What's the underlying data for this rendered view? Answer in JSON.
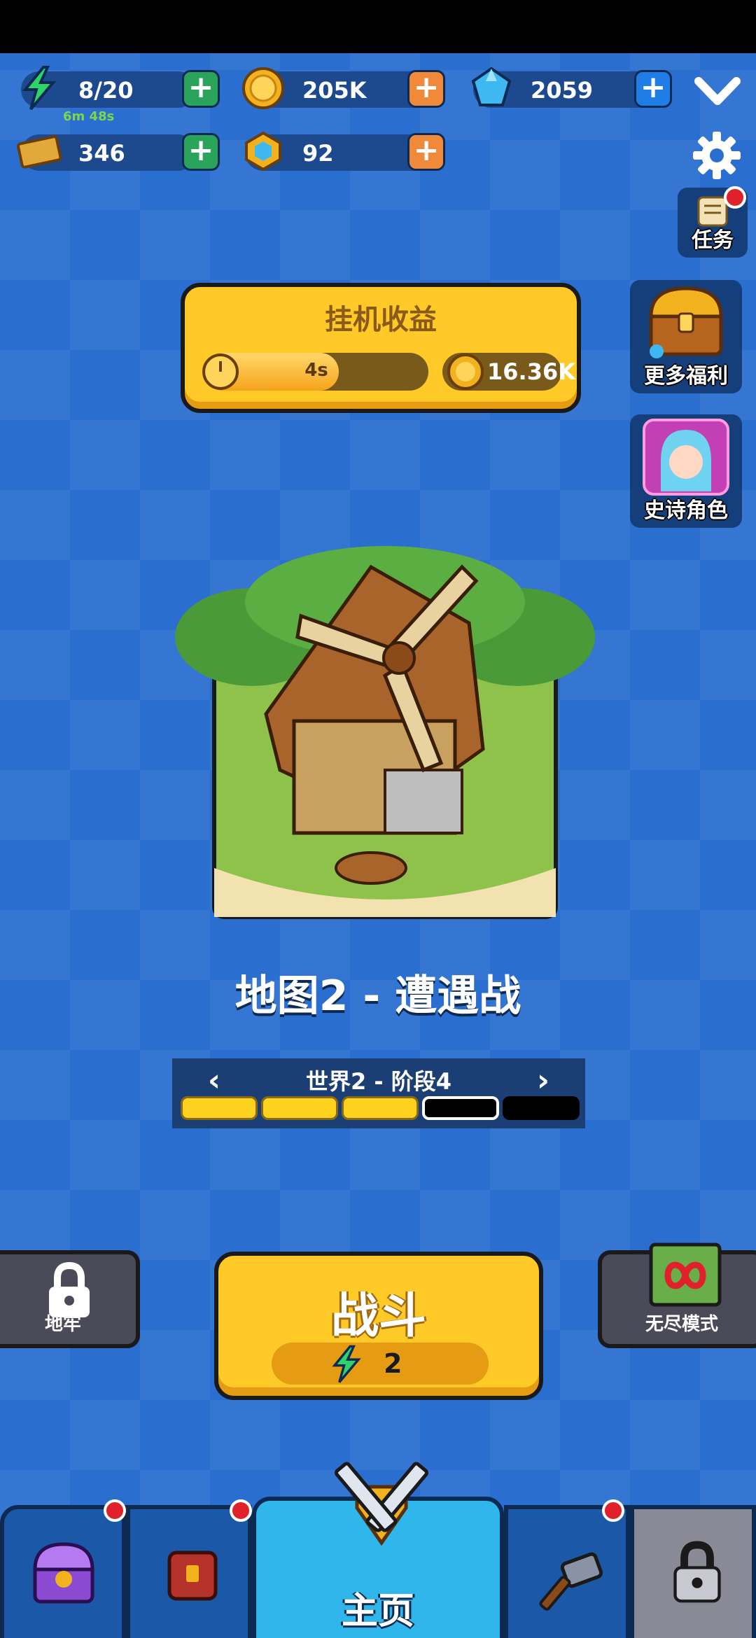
{
  "resources": {
    "energy": {
      "value": "8/20",
      "timer": "6m 48s"
    },
    "gold": {
      "value": "205K"
    },
    "gems": {
      "value": "2059"
    },
    "tickets": {
      "value": "346"
    },
    "hex_tokens": {
      "value": "92"
    }
  },
  "side_buttons": {
    "tasks": "任务",
    "more_benefits": "更多福利",
    "epic_hero": "史诗角色"
  },
  "idle_earnings": {
    "title": "挂机收益",
    "timer": "4s",
    "progress": 0.6,
    "reward": "16.36K"
  },
  "map": {
    "title": "地图2 - 遭遇战",
    "stage_label": "世界2 - 阶段4",
    "stages": [
      "full",
      "full",
      "full",
      "current",
      "empty"
    ]
  },
  "modes": {
    "dungeon": "地牢",
    "endless": "无尽模式"
  },
  "battle": {
    "label": "战斗",
    "energy_cost": "2"
  },
  "nav": {
    "home": "主页"
  },
  "colors": {
    "background": "#2a6fd0",
    "accent_yellow": "#ffc928",
    "notification_red": "#e0202a"
  }
}
